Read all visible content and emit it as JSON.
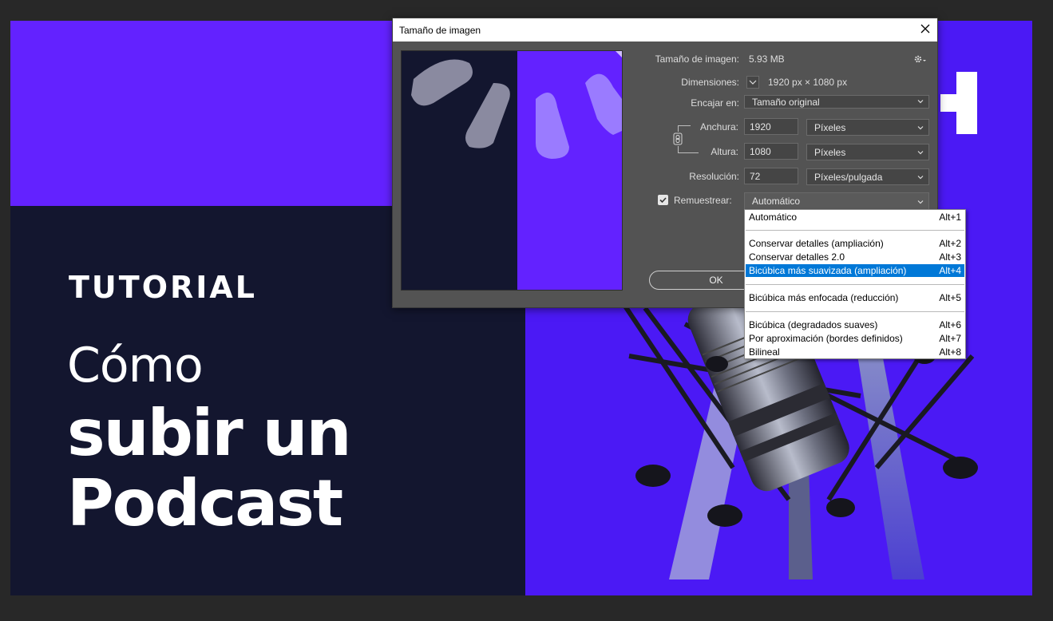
{
  "artwork": {
    "tutorial": "TUTORIAL",
    "line1": "Cómo",
    "line2": "subir un",
    "line3": "Podcast"
  },
  "dialog": {
    "title": "Tamaño de imagen",
    "image_size_label": "Tamaño de imagen:",
    "image_size_value": "5.93 MB",
    "dimensions_label": "Dimensiones:",
    "dimensions_value": "1920 px × 1080 px",
    "fit_label": "Encajar en:",
    "fit_value": "Tamaño original",
    "width_label": "Anchura:",
    "width_value": "1920",
    "width_unit": "Píxeles",
    "height_label": "Altura:",
    "height_value": "1080",
    "height_unit": "Píxeles",
    "resolution_label": "Resolución:",
    "resolution_value": "72",
    "resolution_unit": "Píxeles/pulgada",
    "resample_label": "Remuestrear:",
    "resample_checked": true,
    "resample_value": "Automático",
    "ok_label": "OK"
  },
  "resample_menu": {
    "items": [
      {
        "label": "Automático",
        "shortcut": "Alt+1"
      },
      {
        "label": "Conservar detalles (ampliación)",
        "shortcut": "Alt+2"
      },
      {
        "label": "Conservar detalles 2.0",
        "shortcut": "Alt+3"
      },
      {
        "label": "Bicúbica más suavizada (ampliación)",
        "shortcut": "Alt+4",
        "selected": true
      },
      {
        "label": "Bicúbica más enfocada (reducción)",
        "shortcut": "Alt+5"
      },
      {
        "label": "Bicúbica (degradados suaves)",
        "shortcut": "Alt+6"
      },
      {
        "label": "Por aproximación (bordes definidos)",
        "shortcut": "Alt+7"
      },
      {
        "label": "Bilineal",
        "shortcut": "Alt+8"
      }
    ]
  },
  "colors": {
    "accent_purple": "#6322ff",
    "navy": "#13162f",
    "selection_blue": "#0078d7",
    "dialog_bg": "#535353"
  },
  "icons": [
    "close-icon",
    "gear-icon",
    "chevron-down-icon",
    "link-chain-icon",
    "checkbox-icon"
  ]
}
